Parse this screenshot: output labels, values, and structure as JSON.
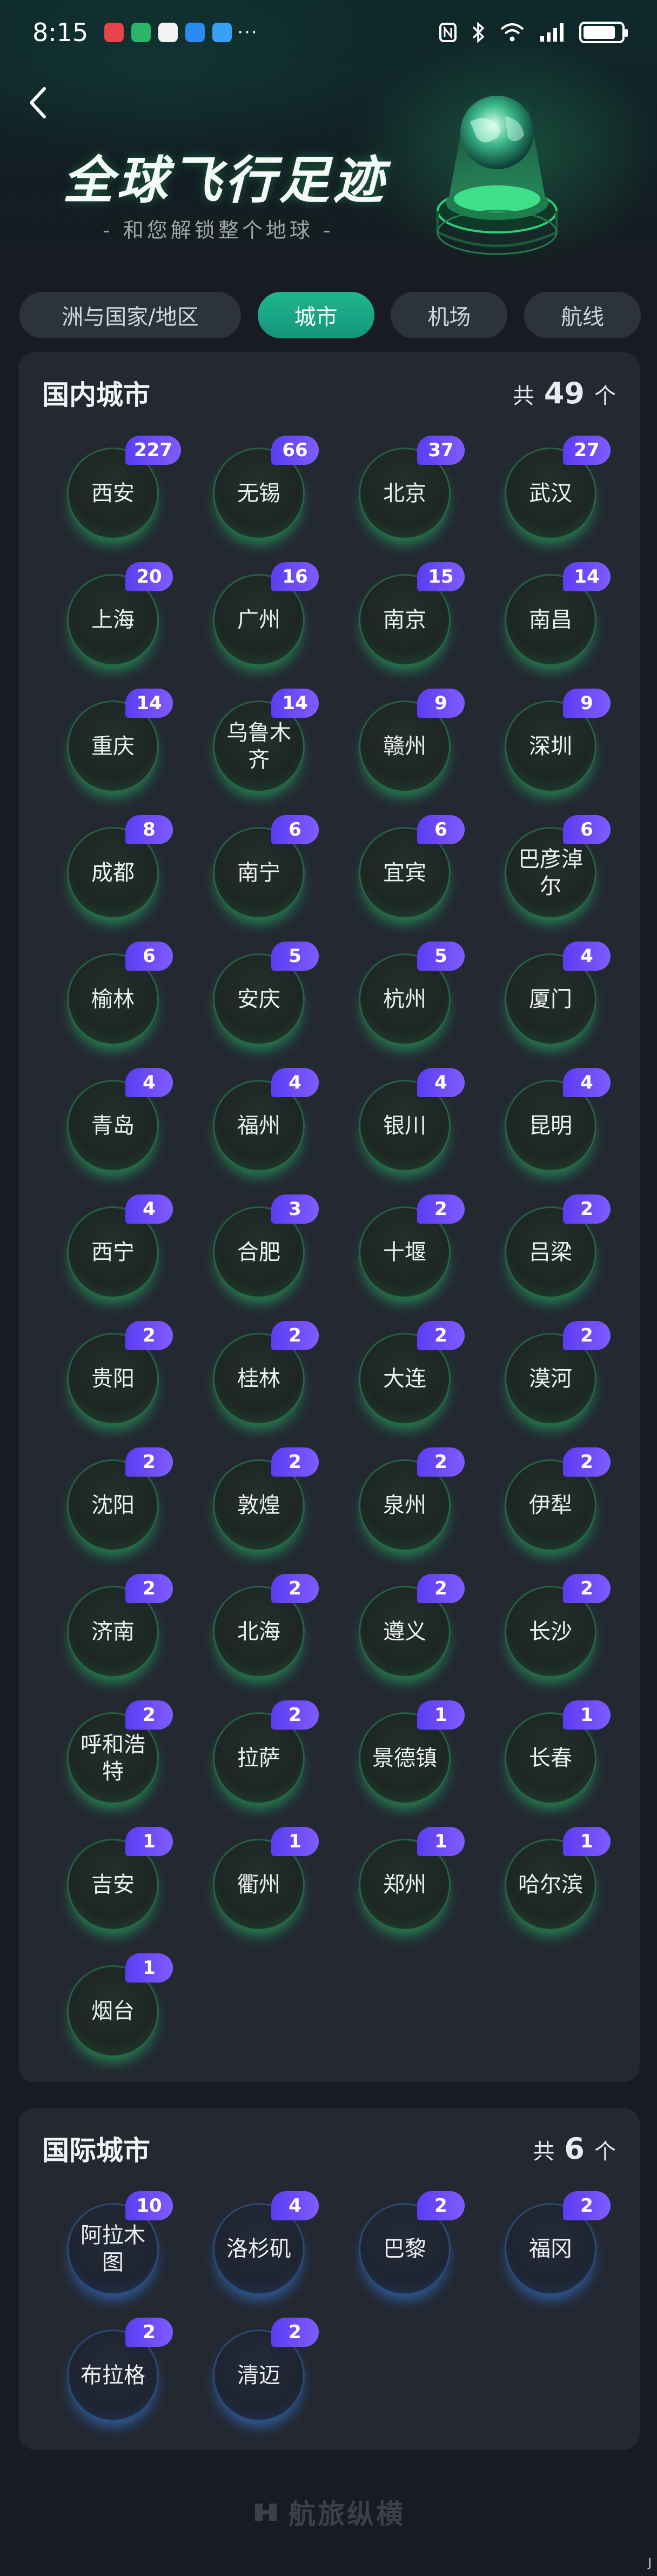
{
  "status_bar": {
    "time": "8:15",
    "more": "···",
    "app_icons": [
      {
        "name": "red-app-icon",
        "color": "#e8424a"
      },
      {
        "name": "green-app-icon",
        "color": "#2cb567"
      },
      {
        "name": "office-app-icon",
        "color": "#f3f3f3"
      },
      {
        "name": "cloud-app-icon",
        "color": "#2b8af0"
      },
      {
        "name": "browser-app-icon",
        "color": "#3aa0f5"
      }
    ],
    "battery_level": 0.85
  },
  "header": {
    "title": "全球飞行足迹",
    "subtitle": "- 和您解锁整个地球 -"
  },
  "tabs": [
    {
      "label": "洲与国家/地区",
      "active": false
    },
    {
      "label": "城市",
      "active": true
    },
    {
      "label": "机场",
      "active": false
    },
    {
      "label": "航线",
      "active": false
    }
  ],
  "domestic": {
    "title": "国内城市",
    "count_prefix": "共",
    "count": "49",
    "count_suffix": "个",
    "cities": [
      {
        "name": "西安",
        "count": "227"
      },
      {
        "name": "无锡",
        "count": "66"
      },
      {
        "name": "北京",
        "count": "37"
      },
      {
        "name": "武汉",
        "count": "27"
      },
      {
        "name": "上海",
        "count": "20"
      },
      {
        "name": "广州",
        "count": "16"
      },
      {
        "name": "南京",
        "count": "15"
      },
      {
        "name": "南昌",
        "count": "14"
      },
      {
        "name": "重庆",
        "count": "14"
      },
      {
        "name": "乌鲁木齐",
        "count": "14"
      },
      {
        "name": "赣州",
        "count": "9"
      },
      {
        "name": "深圳",
        "count": "9"
      },
      {
        "name": "成都",
        "count": "8"
      },
      {
        "name": "南宁",
        "count": "6"
      },
      {
        "name": "宜宾",
        "count": "6"
      },
      {
        "name": "巴彦淖尔",
        "count": "6"
      },
      {
        "name": "榆林",
        "count": "6"
      },
      {
        "name": "安庆",
        "count": "5"
      },
      {
        "name": "杭州",
        "count": "5"
      },
      {
        "name": "厦门",
        "count": "4"
      },
      {
        "name": "青岛",
        "count": "4"
      },
      {
        "name": "福州",
        "count": "4"
      },
      {
        "name": "银川",
        "count": "4"
      },
      {
        "name": "昆明",
        "count": "4"
      },
      {
        "name": "西宁",
        "count": "4"
      },
      {
        "name": "合肥",
        "count": "3"
      },
      {
        "name": "十堰",
        "count": "2"
      },
      {
        "name": "吕梁",
        "count": "2"
      },
      {
        "name": "贵阳",
        "count": "2"
      },
      {
        "name": "桂林",
        "count": "2"
      },
      {
        "name": "大连",
        "count": "2"
      },
      {
        "name": "漠河",
        "count": "2"
      },
      {
        "name": "沈阳",
        "count": "2"
      },
      {
        "name": "敦煌",
        "count": "2"
      },
      {
        "name": "泉州",
        "count": "2"
      },
      {
        "name": "伊犁",
        "count": "2"
      },
      {
        "name": "济南",
        "count": "2"
      },
      {
        "name": "北海",
        "count": "2"
      },
      {
        "name": "遵义",
        "count": "2"
      },
      {
        "name": "长沙",
        "count": "2"
      },
      {
        "name": "呼和浩特",
        "count": "2"
      },
      {
        "name": "拉萨",
        "count": "2"
      },
      {
        "name": "景德镇",
        "count": "1"
      },
      {
        "name": "长春",
        "count": "1"
      },
      {
        "name": "吉安",
        "count": "1"
      },
      {
        "name": "衢州",
        "count": "1"
      },
      {
        "name": "郑州",
        "count": "1"
      },
      {
        "name": "哈尔滨",
        "count": "1"
      },
      {
        "name": "烟台",
        "count": "1"
      }
    ]
  },
  "international": {
    "title": "国际城市",
    "count_prefix": "共",
    "count": "6",
    "count_suffix": "个",
    "cities": [
      {
        "name": "阿拉木图",
        "count": "10"
      },
      {
        "name": "洛杉矶",
        "count": "4"
      },
      {
        "name": "巴黎",
        "count": "2"
      },
      {
        "name": "福冈",
        "count": "2"
      },
      {
        "name": "布拉格",
        "count": "2"
      },
      {
        "name": "清迈",
        "count": "2"
      }
    ]
  },
  "footer": {
    "brand": "航旅纵横",
    "corner_mark": "J"
  }
}
